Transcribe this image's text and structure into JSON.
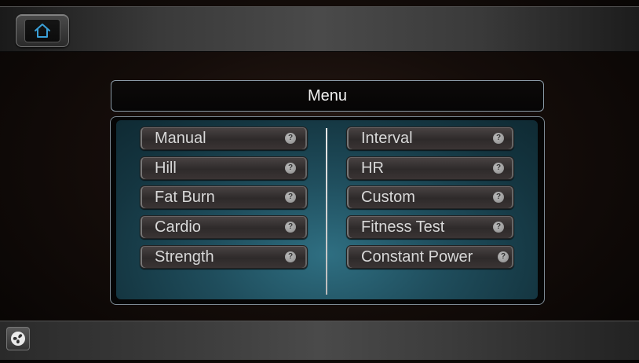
{
  "header": {
    "home_icon": "home-icon"
  },
  "menu": {
    "title": "Menu",
    "left_items": [
      {
        "label": "Manual"
      },
      {
        "label": "Hill"
      },
      {
        "label": "Fat Burn"
      },
      {
        "label": "Cardio"
      },
      {
        "label": "Strength"
      }
    ],
    "right_items": [
      {
        "label": "Interval"
      },
      {
        "label": "HR"
      },
      {
        "label": "Custom"
      },
      {
        "label": "Fitness Test"
      },
      {
        "label": "Constant Power"
      }
    ],
    "info_icon_glyph": "?"
  },
  "footer": {
    "fan_icon": "fan-icon"
  },
  "colors": {
    "panel_teal": "#1f4d5c",
    "accent_blue": "#3aa0d8"
  }
}
